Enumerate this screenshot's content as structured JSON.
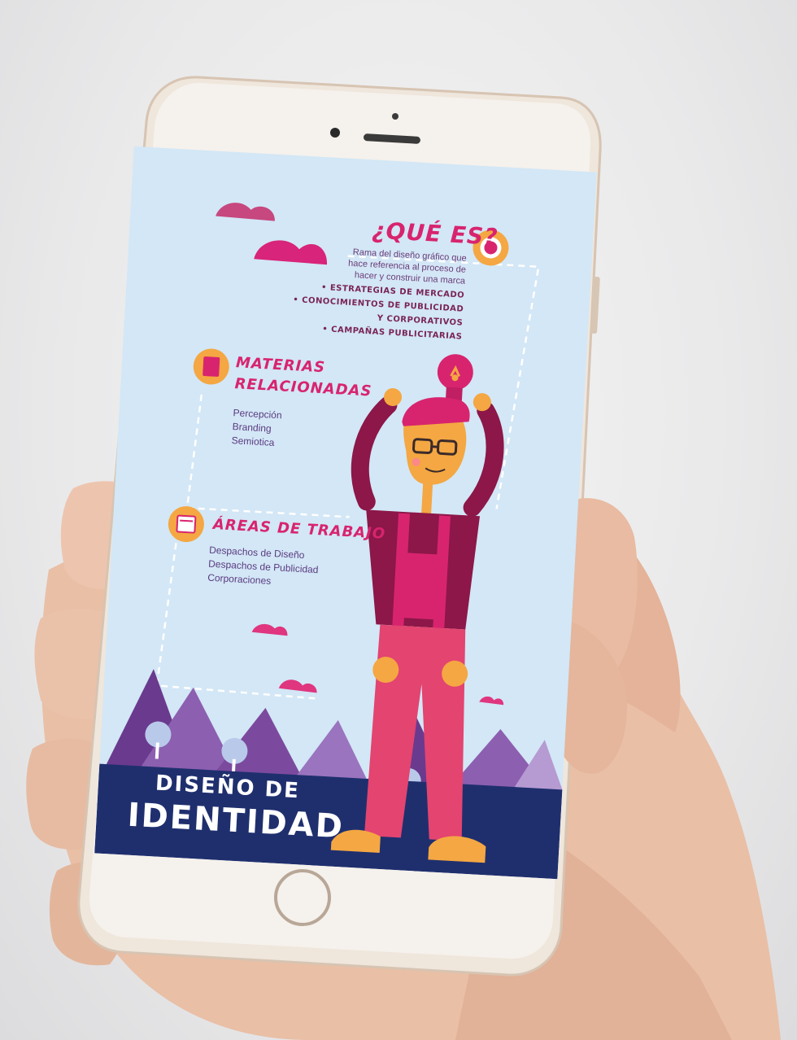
{
  "screen": {
    "que_es": {
      "title": "¿QUÉ ES?",
      "description": [
        "Rama del diseño gráfico que",
        "hace referencia al proceso de",
        "hacer y construir una marca"
      ],
      "bullets": [
        "• ESTRATEGIAS DE MERCADO",
        "• CONOCIMIENTOS DE PUBLICIDAD",
        "Y CORPORATIVOS",
        "• CAMPAÑAS PUBLICITARIAS"
      ]
    },
    "materias": {
      "title_line1": "MATERIAS",
      "title_line2": "RELACIONADAS",
      "items": [
        "Percepción",
        "Branding",
        "Semiotica"
      ]
    },
    "areas": {
      "title": "ÁREAS DE TRABAJO",
      "items": [
        "Despachos de Diseño",
        "Despachos de Publicidad",
        "Corporaciones"
      ]
    },
    "footer": {
      "line1": "DISEÑO DE",
      "line2": "IDENTIDAD"
    }
  },
  "colors": {
    "screen_bg": "#d3e7f6",
    "accent_pink": "#d8246f",
    "accent_orange": "#f4a742",
    "mountain_purple": "#7b4a9e",
    "footer_navy": "#1f2f6e",
    "phone_frame": "#efe6dc"
  },
  "icons": [
    "info-icon",
    "book-icon",
    "briefcase-icon",
    "lightbulb-icon",
    "cloud-icon",
    "mountain-icon",
    "tree-icon"
  ]
}
